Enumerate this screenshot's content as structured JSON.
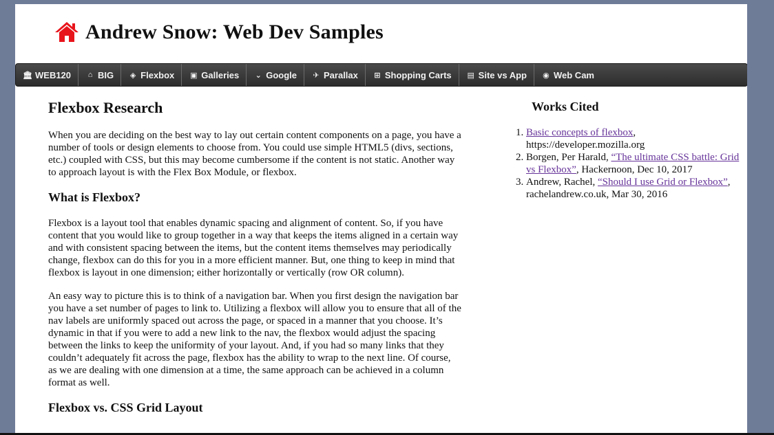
{
  "site": {
    "title": "Andrew Snow: Web Dev Samples"
  },
  "nav": {
    "items": [
      {
        "label": "WEB120",
        "icon": "bank-icon"
      },
      {
        "label": "BIG",
        "icon": "home-icon"
      },
      {
        "label": "Flexbox",
        "icon": "cube-icon"
      },
      {
        "label": "Galleries",
        "icon": "picture-icon"
      },
      {
        "label": "Google",
        "icon": "chevron-down-icon"
      },
      {
        "label": "Parallax",
        "icon": "plane-icon"
      },
      {
        "label": "Shopping Carts",
        "icon": "basket-icon"
      },
      {
        "label": "Site vs App",
        "icon": "document-icon"
      },
      {
        "label": "Web Cam",
        "icon": "eye-icon"
      }
    ]
  },
  "article": {
    "title": "Flexbox Research",
    "intro": "When you are deciding on the best way to lay out certain content components on a page, you have a number of tools or design elements to choose from. You could use simple HTML5 (divs, sections, etc.) coupled with CSS, but this may become cumbersome if the content is not static. Another way to approach layout is with the Flex Box Module, or flexbox.",
    "section1_heading": "What is Flexbox?",
    "section1_p1": "Flexbox is a layout tool that enables dynamic spacing and alignment of content. So, if you have content that you would like to group together in a way that keeps the items aligned in a certain way and with consistent spacing between the items, but the content items themselves may periodically change, flexbox can do this for you in a more efficient manner. But, one thing to keep in mind that flexbox is layout in one dimension; either horizontally or vertically (row OR column).",
    "section1_p2": "An easy way to picture this is to think of a navigation bar. When you first design the navigation bar you have a set number of pages to link to. Utilizing a flexbox will allow you to ensure that all of the nav labels are uniformly spaced out across the page, or spaced in a manner that you choose. It’s dynamic in that if you were to add a new link to the nav, the flexbox would adjust the spacing between the links to keep the uniformity of your layout. And, if you had so many links that they couldn’t adequately fit across the page, flexbox has the ability to wrap to the next line. Of course, as we are dealing with one dimension at a time, the same approach can be achieved in a column format as well.",
    "section2_heading": "Flexbox vs. CSS Grid Layout"
  },
  "works_cited": {
    "heading": "Works Cited",
    "items": [
      {
        "link": "Basic concepts of flexbox",
        "rest": ", https://developer.mozilla.org"
      },
      {
        "prefix": "Borgen, Per Harald, ",
        "link": "“The ultimate CSS battle: Grid vs Flexbox”",
        "rest": ", Hackernoon, Dec 10, 2017"
      },
      {
        "prefix": "Andrew, Rachel, ",
        "link": "“Should I use Grid or Flexbox”",
        "rest": ", rachelandrew.co.uk, Mar 30, 2016"
      }
    ]
  },
  "colors": {
    "home_icon": "#e8141b",
    "link": "#663399",
    "nav_bg": "#333333",
    "backdrop": "#6f7c98"
  }
}
